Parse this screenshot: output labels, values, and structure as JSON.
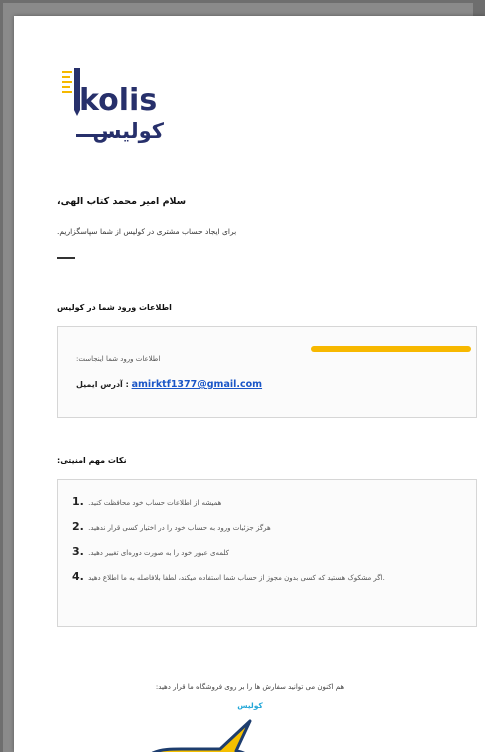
{
  "logo": {
    "latin": "kolis",
    "persian": "کولیس"
  },
  "greeting": "،سلام امیر محمد کتاب الهی",
  "intro": ".برای ایجاد حساب مشتری در کولیس از شما سپاسگزاریم",
  "login_section": {
    "title": "اطلاعات ورود شما در کولیس",
    "hint": ":اطلاعات ورود شما اینجاست",
    "email_label": "آدرس ایمیل :",
    "email": "amirktf1377@gmail.com"
  },
  "tips_section": {
    "title": ":نکات مهم امنیتی",
    "items": [
      {
        "num": "1.",
        "text": ".همیشه از اطلاعات حساب خود محافظت کنید"
      },
      {
        "num": "2.",
        "text": ".هرگز جزئیات ورود به حساب خود را در اختیار کسی قرار ندهید"
      },
      {
        "num": "3.",
        "text": ".کلمه‌ی عبور خود را به صورت دوره‌ای تغییر دهید"
      },
      {
        "num": "4.",
        "text": "اگر مشکوک هستید که کسی بدون مجوز از حساب شما استفاده میکند، لطفا بلافاصله به ما اطلاع دهید."
      }
    ]
  },
  "closing": ":هم اکنون می توانید سفارش ها را بر روی فروشگاه ما قرار دهید",
  "store_link": "کولیس",
  "colors": {
    "highlight": "#f7b800",
    "link": "#1a56c7",
    "store_link": "#23a7d8",
    "logo_navy": "#27306b",
    "logo_yellow": "#f5b800",
    "callout_fill": "#f5c000",
    "callout_stroke": "#1d3d6e"
  }
}
